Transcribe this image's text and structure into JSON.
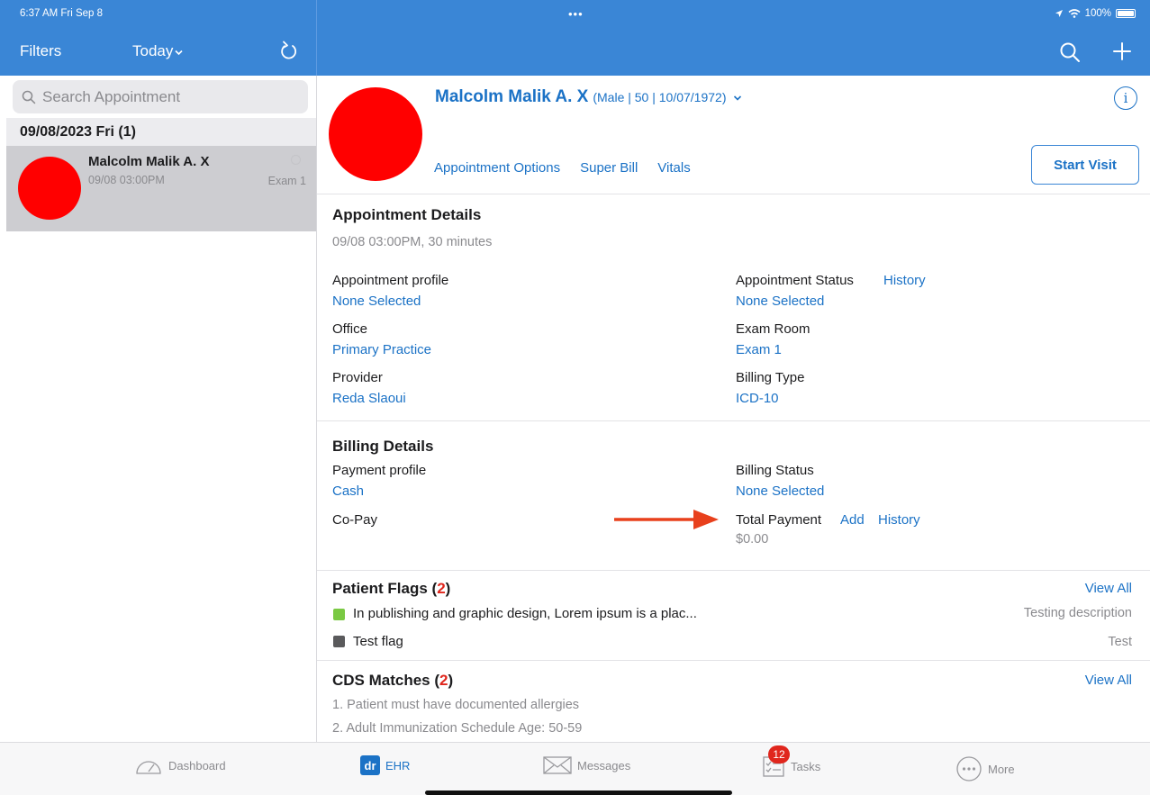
{
  "status_bar": {
    "time": "6:37 AM  Fri Sep 8",
    "dots": "•••",
    "battery": "100%"
  },
  "nav": {
    "filters": "Filters",
    "today": "Today"
  },
  "sidebar": {
    "search_placeholder": "Search Appointment",
    "date_header": "09/08/2023 Fri (1)",
    "appointment": {
      "name": "Malcolm Malik A. X",
      "time": "09/08 03:00PM",
      "room": "Exam 1"
    }
  },
  "patient": {
    "name": "Malcolm Malik A. X",
    "demographics": "(Male | 50 | 10/07/1972)",
    "links": [
      "Appointment Options",
      "Super Bill",
      "Vitals"
    ],
    "start_visit": "Start Visit"
  },
  "appointment_details": {
    "title": "Appointment Details",
    "summary": "09/08 03:00PM, 30 minutes",
    "fields": {
      "profile_label": "Appointment profile",
      "profile_value": "None Selected",
      "status_label": "Appointment Status",
      "status_history": "History",
      "status_value": "None Selected",
      "office_label": "Office",
      "office_value": "Primary Practice",
      "room_label": "Exam Room",
      "room_value": "Exam 1",
      "provider_label": "Provider",
      "provider_value": "Reda Slaoui",
      "billing_type_label": "Billing Type",
      "billing_type_value": "ICD-10"
    }
  },
  "billing_details": {
    "title": "Billing Details",
    "payment_profile_label": "Payment profile",
    "payment_profile_value": "Cash",
    "billing_status_label": "Billing Status",
    "billing_status_value": "None Selected",
    "copay_label": "Co-Pay",
    "total_payment_label": "Total Payment",
    "add": "Add",
    "history": "History",
    "total_payment_value": "$0.00"
  },
  "patient_flags": {
    "title": "Patient Flags (",
    "count": "2",
    "close": ")",
    "view_all": "View All",
    "items": [
      {
        "text": "In publishing and graphic design, Lorem ipsum is a plac...",
        "description": "Testing description",
        "color": "#7ac943"
      },
      {
        "text": "Test flag",
        "description": "Test",
        "color": "#5a5a5c"
      }
    ]
  },
  "cds_matches": {
    "title": "CDS Matches (",
    "count": "2",
    "close": ")",
    "view_all": "View All",
    "items": [
      "1. Patient must have documented allergies",
      "2. Adult Immunization Schedule Age: 50-59"
    ]
  },
  "tabbar": {
    "dashboard": "Dashboard",
    "ehr_icon": "dr",
    "ehr": "EHR",
    "messages": "Messages",
    "tasks": "Tasks",
    "tasks_badge": "12",
    "more": "More"
  },
  "colors": {
    "header_blue": "#3a86d6",
    "link_blue": "#1b72c6",
    "avatar_red": "#ff0000",
    "badge_red": "#e0261d",
    "arrow_red": "#e8401c"
  }
}
